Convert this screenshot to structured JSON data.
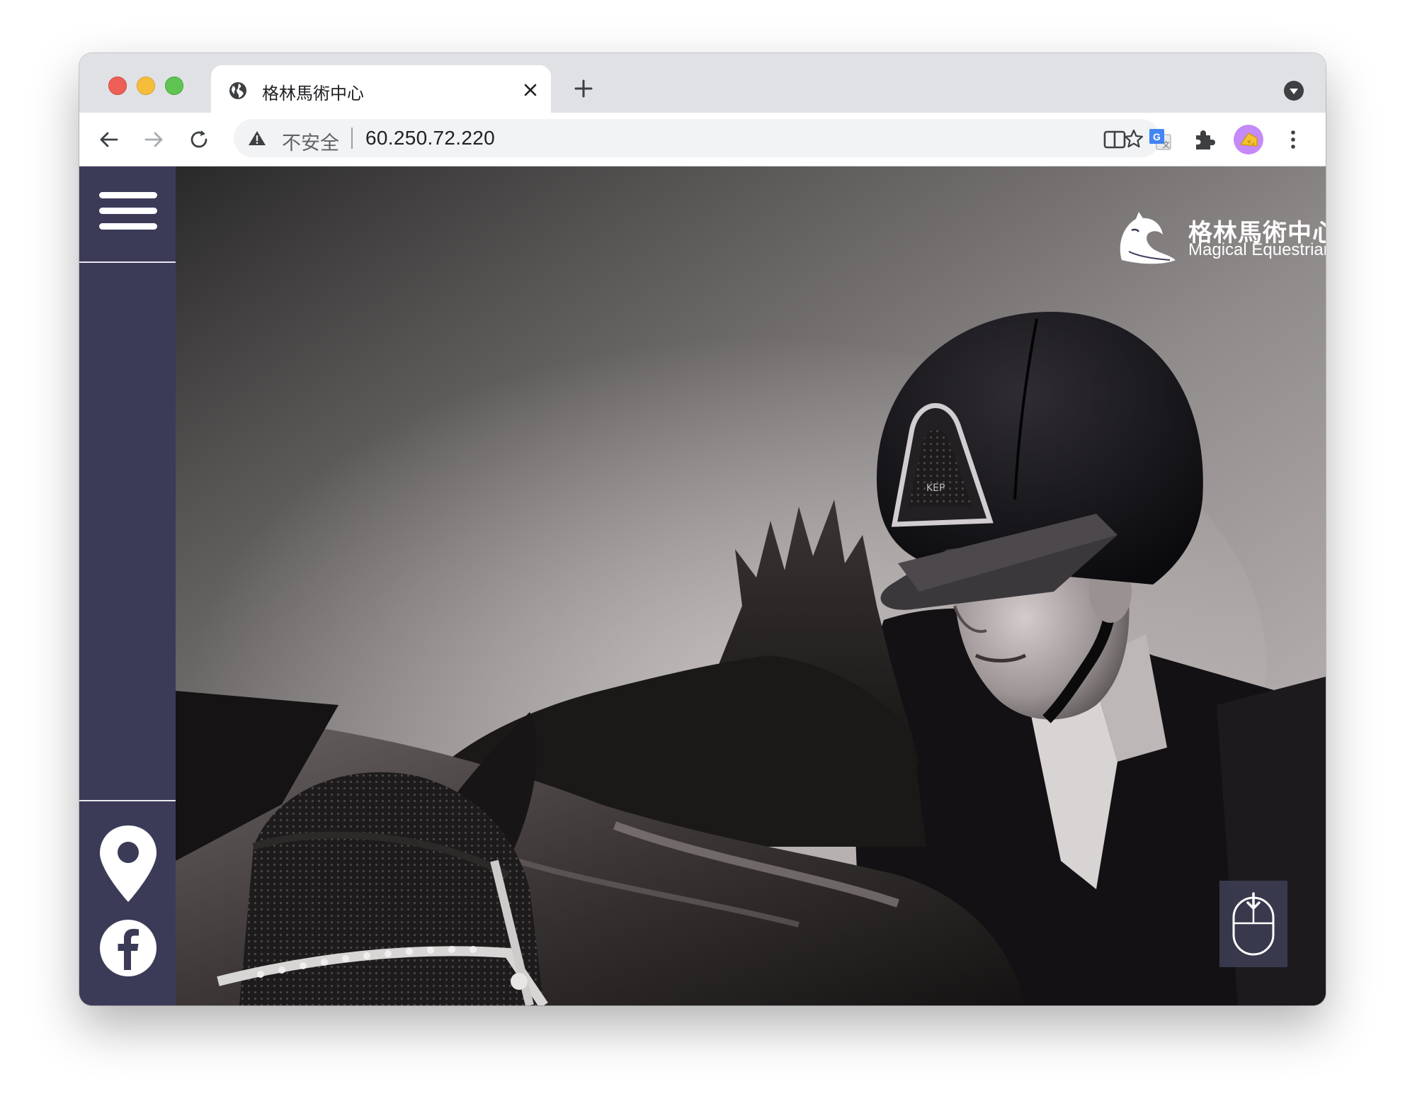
{
  "browser": {
    "tab": {
      "title": "格林馬術中心",
      "icon": "globe-icon"
    },
    "omnibox": {
      "security_label": "不安全",
      "url": "60.250.72.220"
    }
  },
  "site": {
    "brand": {
      "name_zh": "格林馬術中心",
      "name_en": "Magical Equestrian"
    },
    "sidebar": {
      "menu_icon": "hamburger-menu-icon",
      "location_icon": "map-pin-icon",
      "social_icon": "facebook-icon"
    },
    "scroll_icon": "mouse-scroll-down-icon"
  },
  "colors": {
    "sidebar_bg": "#3b3b58",
    "tabstrip_bg": "#dfe1e5",
    "profile_avatar": "#c58af9"
  }
}
